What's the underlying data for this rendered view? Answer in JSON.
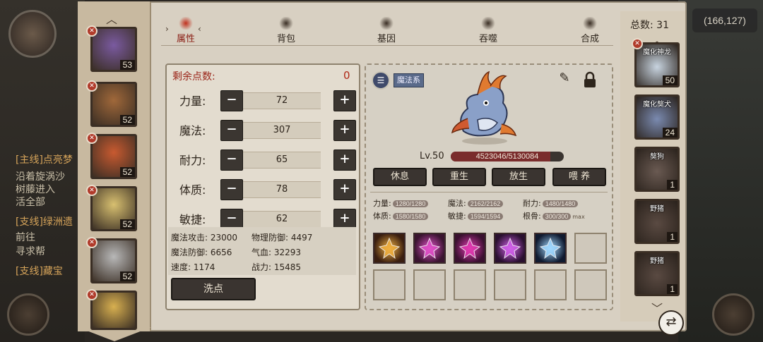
{
  "top_coords": "(166,127)",
  "quests": [
    {
      "text": "[主线]点亮梦",
      "type": "t"
    },
    {
      "text": "沿着旋涡沙",
      "type": "n"
    },
    {
      "text": "树藤进入",
      "type": "n"
    },
    {
      "text": "活全部",
      "type": "n"
    },
    {
      "text": "[支线]绿洲遗",
      "type": "t"
    },
    {
      "text": "前往",
      "type": "n"
    },
    {
      "text": "寻求帮",
      "type": "n"
    },
    {
      "text": "[支线]藏宝",
      "type": "t"
    }
  ],
  "heroes": [
    {
      "level": "53",
      "color": "#7a5aa0"
    },
    {
      "level": "52",
      "color": "#a0683a"
    },
    {
      "level": "52",
      "color": "#c85a30"
    },
    {
      "level": "52",
      "color": "#d8c070"
    },
    {
      "level": "52",
      "color": "#b8b8b8"
    },
    {
      "level": "",
      "color": "#d8b050"
    }
  ],
  "tabs": [
    "属性",
    "背包",
    "基因",
    "吞噬",
    "合成"
  ],
  "active_tab": "属性",
  "stats": {
    "remaining_label": "剩余点数:",
    "remaining_value": "0",
    "rows": [
      {
        "label": "力量:",
        "value": "72"
      },
      {
        "label": "魔法:",
        "value": "307"
      },
      {
        "label": "耐力:",
        "value": "65"
      },
      {
        "label": "体质:",
        "value": "78"
      },
      {
        "label": "敏捷:",
        "value": "62"
      }
    ],
    "derived": [
      "魔法攻击: 23000",
      "物理防御: 4497",
      "魔法防御: 6656",
      "气血: 32293",
      "速度: 1174",
      "战力: 15485"
    ],
    "reset_label": "洗点"
  },
  "pet": {
    "school": "魔法系",
    "level": "Lv.50",
    "hp_text": "4523046/5130084",
    "hp_fraction": 0.8817,
    "actions": [
      "休息",
      "重生",
      "放生",
      "喂 养"
    ],
    "attributes": [
      {
        "label": "力量:",
        "value": "1280/1280"
      },
      {
        "label": "魔法:",
        "value": "2162/2162"
      },
      {
        "label": "耐力:",
        "value": "1480/1480"
      },
      {
        "label": "体质:",
        "value": "1580/1580"
      },
      {
        "label": "敏捷:",
        "value": "1594/1594"
      },
      {
        "label": "根骨:",
        "value": "300/300"
      }
    ],
    "max_label": "max",
    "skill_icons": [
      "gold-swirl-skill-icon",
      "pink-claw-skill-icon",
      "magenta-burst-skill-icon",
      "violet-star-skill-icon",
      "blue-crest-skill-icon"
    ],
    "empty_slots": 7
  },
  "pet_list": {
    "total_label": "总数: 31",
    "pets": [
      {
        "name": "魔化神龙",
        "level": "50",
        "color": "#c8d4e0"
      },
      {
        "name": "魔化獒犬",
        "level": "24",
        "color": "#7a8ab0"
      },
      {
        "name": "獒狗",
        "level": "1",
        "color": "#6a5a52"
      },
      {
        "name": "野猪",
        "level": "1",
        "color": "#5a4a42"
      },
      {
        "name": "野猪",
        "level": "1",
        "color": "#5a4a42"
      }
    ]
  },
  "colors": {
    "panel": "#d8d0c2",
    "accent_red": "#8a1e14",
    "dark_button": "#3a3430"
  }
}
